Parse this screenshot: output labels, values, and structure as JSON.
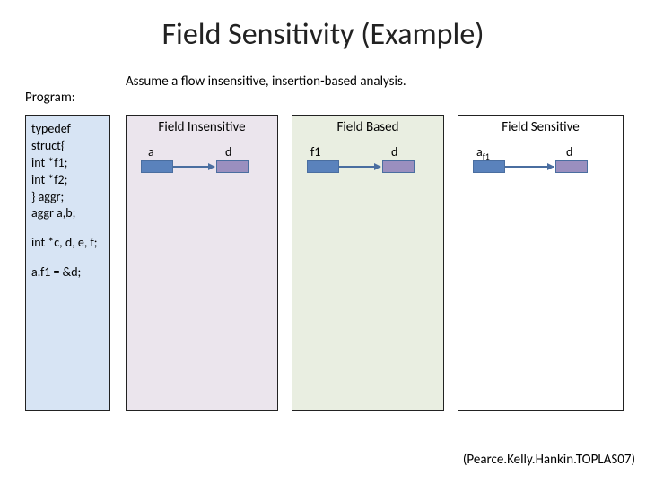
{
  "title": "Field Sensitivity (Example)",
  "assume": "Assume a flow insensitive, insertion-based analysis.",
  "program_label": "Program:",
  "code": {
    "block1": "typedef struct{\n int *f1;\n int *f2;\n} aggr;\naggr a,b;",
    "block2": "int *c, d, e, f;",
    "block3": "a.f1 = &d;"
  },
  "panels": {
    "fi": {
      "title": "Field Insensitive",
      "left_label": "a",
      "right_label": "d"
    },
    "fb": {
      "title": "Field Based",
      "left_label": "f1",
      "right_label": "d"
    },
    "fs": {
      "title": "Field Sensitive",
      "left_label_main": "a",
      "left_label_sub": "f1",
      "right_label": "d"
    }
  },
  "citation": "(Pearce.Kelly.Hankin.TOPLAS07)"
}
